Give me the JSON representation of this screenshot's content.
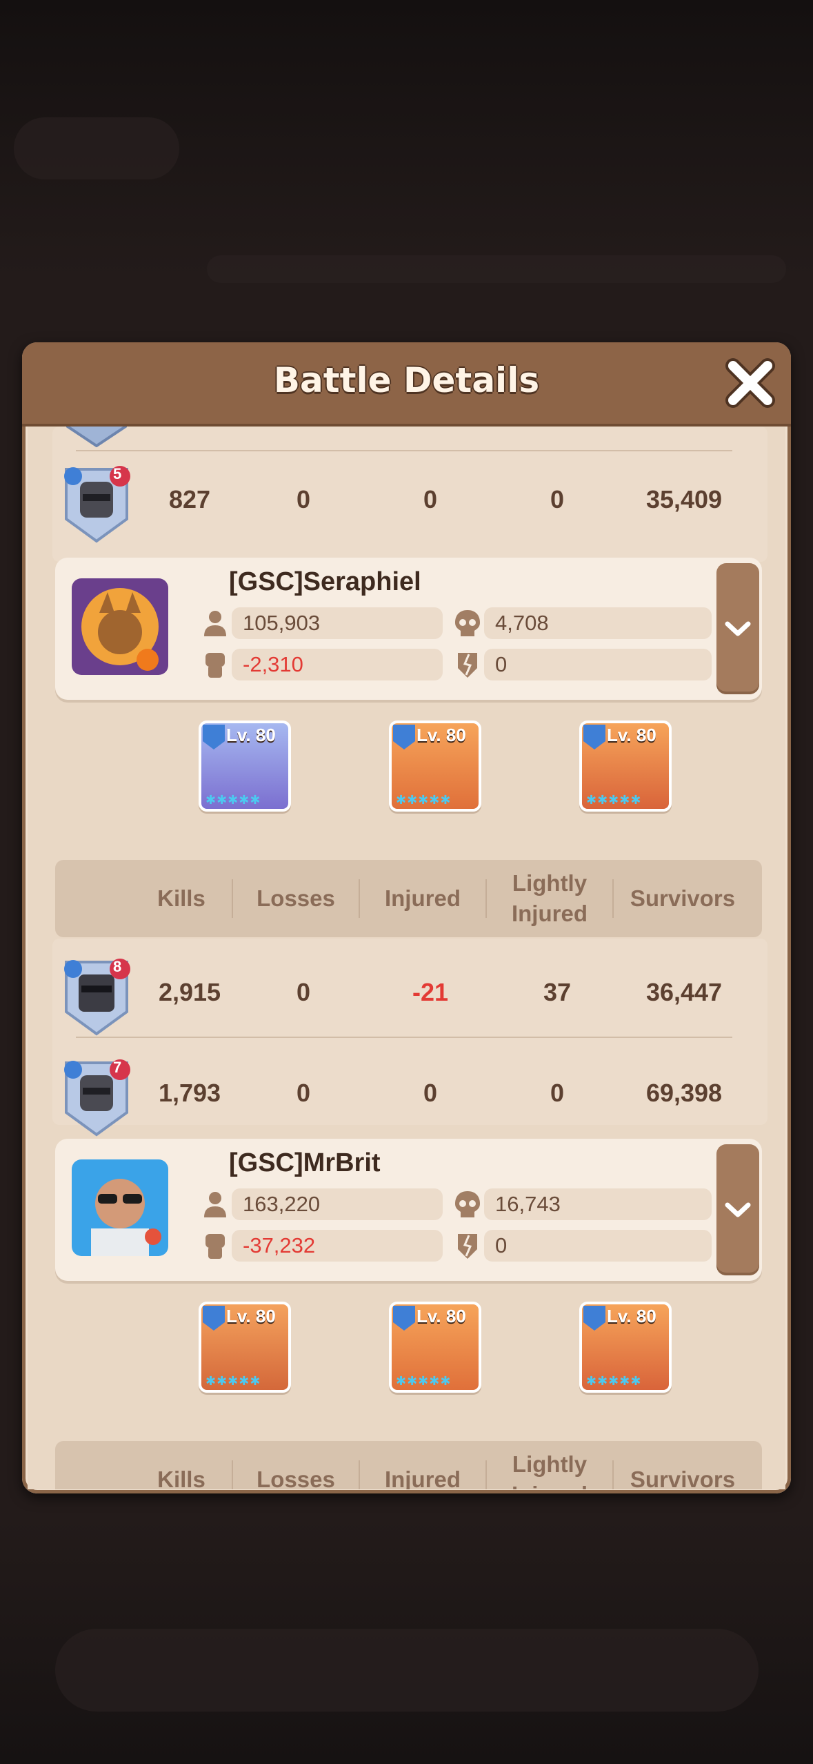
{
  "modal": {
    "title": "Battle Details"
  },
  "columns": [
    "Kills",
    "Losses",
    "Injured",
    "Lightly Injured",
    "Survivors"
  ],
  "header_lightly": [
    "Lightly",
    "Injured"
  ],
  "top_unit_rows": [
    {
      "level": "5",
      "kills": "827",
      "losses": "0",
      "injured": "0",
      "lightly": "0",
      "survivors": "35,409"
    }
  ],
  "players": [
    {
      "name": "[GSC]Seraphiel",
      "troops": "105,903",
      "kills": "4,708",
      "power_change": "-2,310",
      "wounded": "0",
      "commanders": [
        {
          "level": "Lv. 80",
          "stars": "✱✱✱✱✱"
        },
        {
          "level": "Lv. 80",
          "stars": "✱✱✱✱✱"
        },
        {
          "level": "Lv. 80",
          "stars": "✱✱✱✱✱"
        }
      ],
      "units": [
        {
          "level": "8",
          "kills": "2,915",
          "losses": "0",
          "injured": "-21",
          "lightly": "37",
          "survivors": "36,447"
        },
        {
          "level": "7",
          "kills": "1,793",
          "losses": "0",
          "injured": "0",
          "lightly": "0",
          "survivors": "69,398"
        }
      ]
    },
    {
      "name": "[GSC]MrBrit",
      "troops": "163,220",
      "kills": "16,743",
      "power_change": "-37,232",
      "wounded": "0",
      "commanders": [
        {
          "level": "Lv. 80",
          "stars": "✱✱✱✱✱"
        },
        {
          "level": "Lv. 80",
          "stars": "✱✱✱✱✱"
        },
        {
          "level": "Lv. 80",
          "stars": "✱✱✱✱✱"
        }
      ]
    }
  ],
  "colors": {
    "header_brown": "#8d6447",
    "panel": "#efe0cf",
    "negative": "#e33a34",
    "star": "#4cc9f0"
  }
}
